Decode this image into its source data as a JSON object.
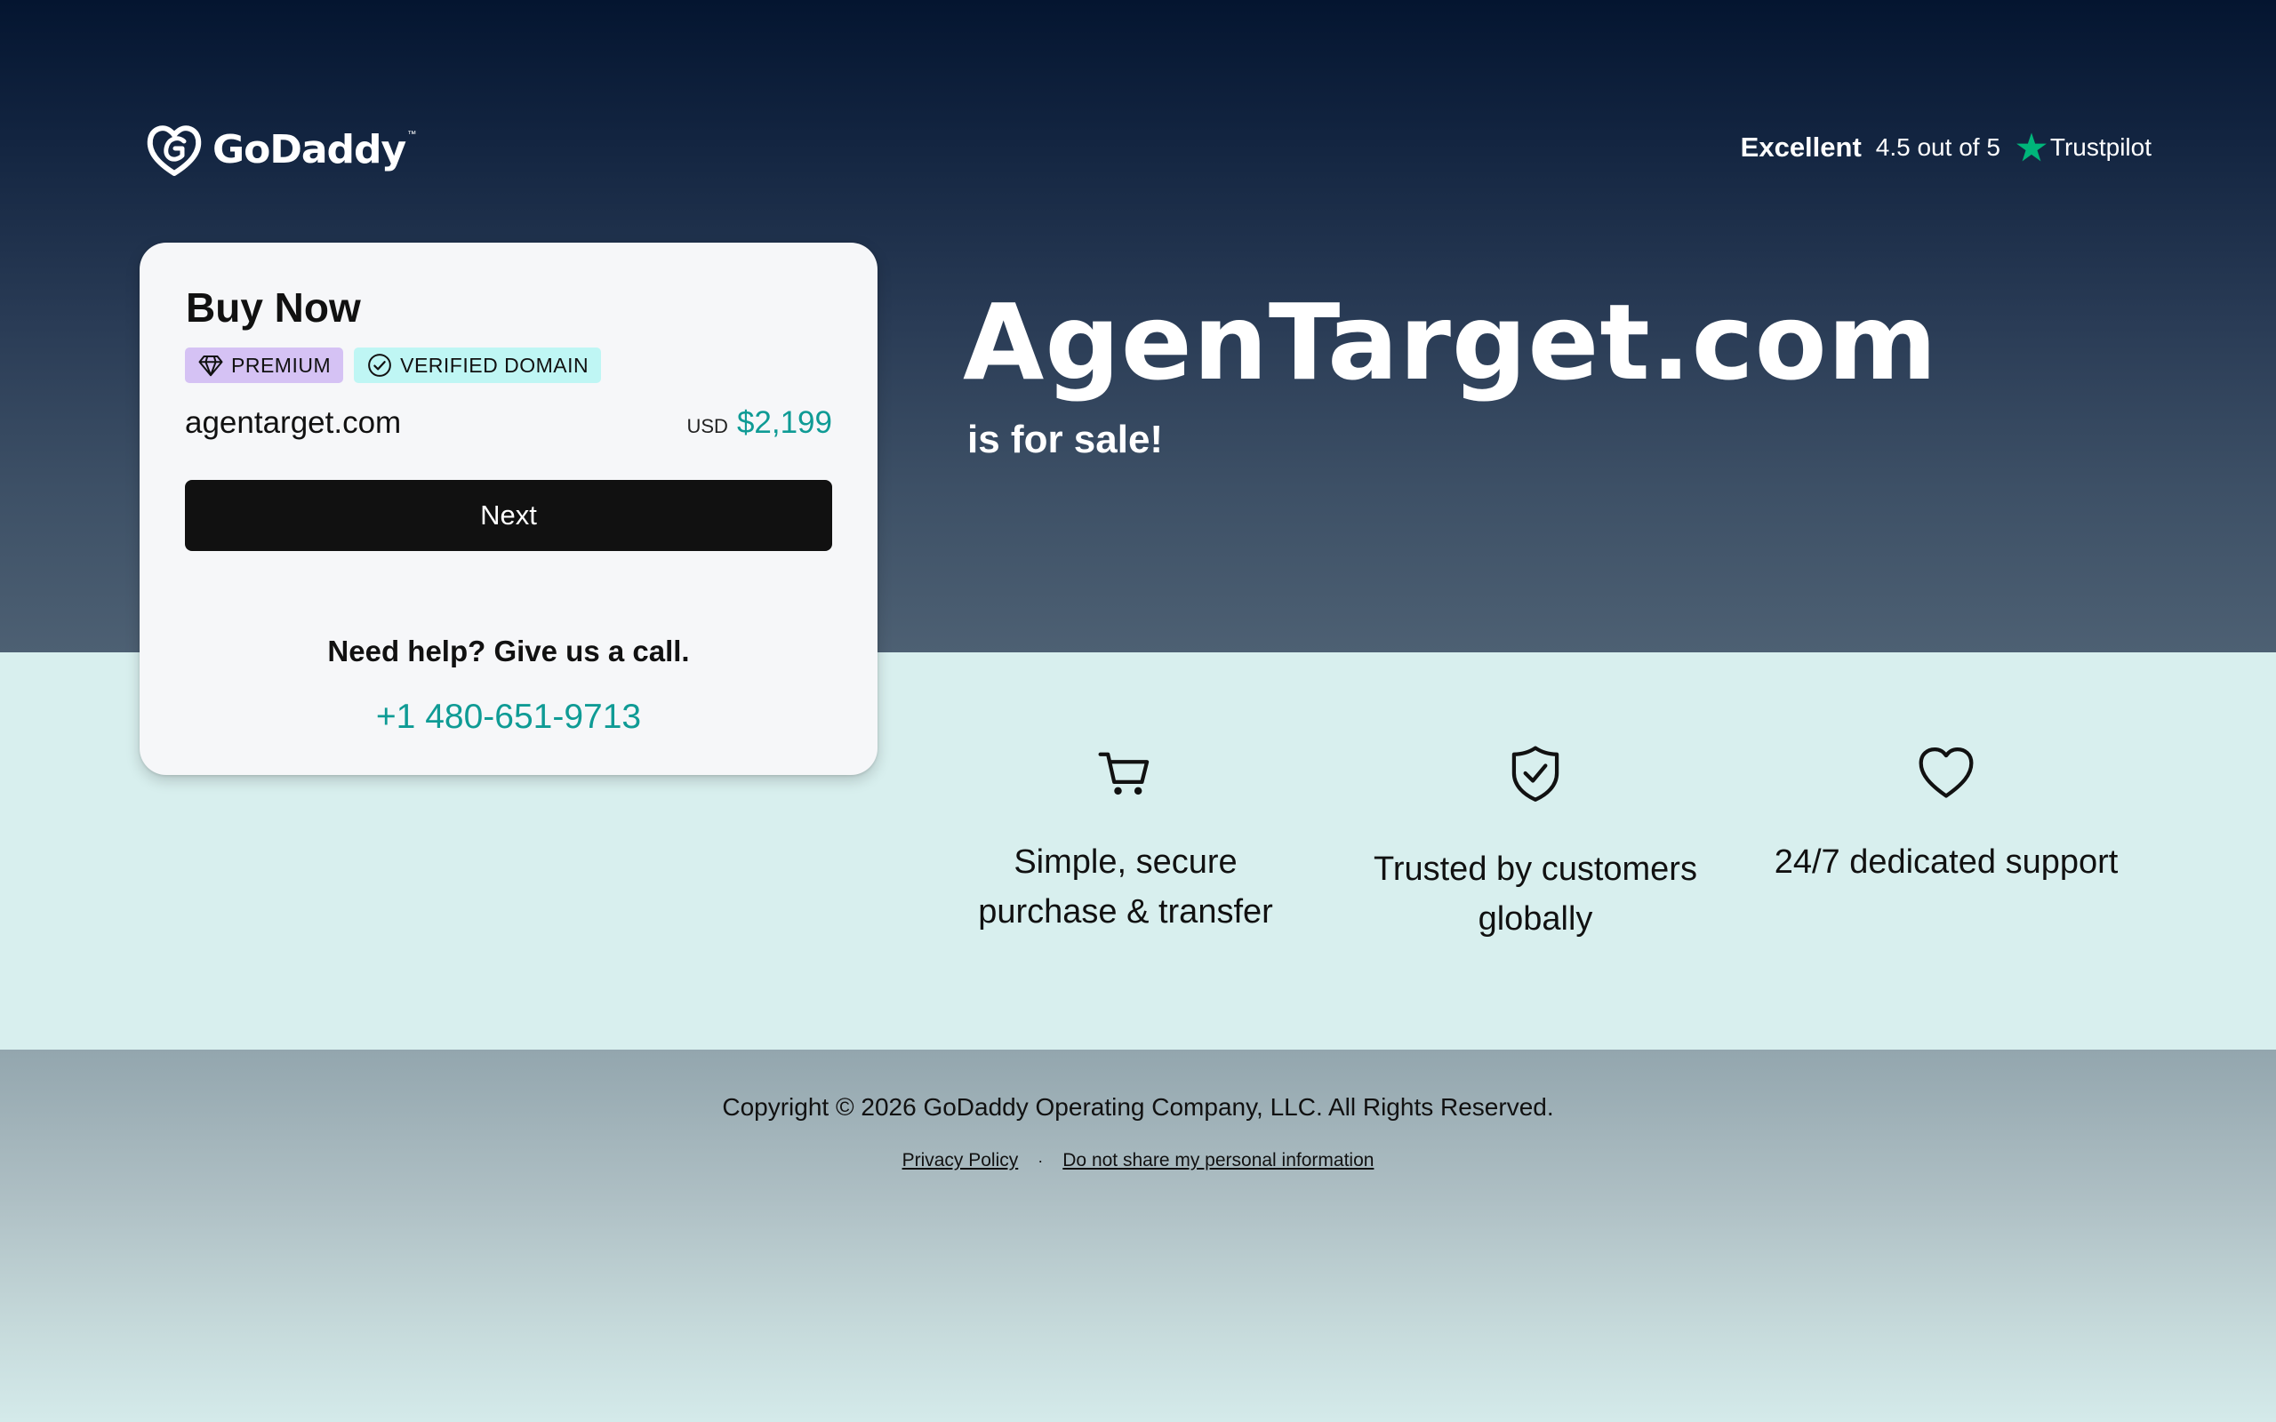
{
  "header": {
    "logo_text": "GoDaddy",
    "logo_tm": "™",
    "trustpilot": {
      "rating_word": "Excellent",
      "score": "4.5 out of 5",
      "brand": "Trustpilot"
    }
  },
  "buy_card": {
    "title": "Buy Now",
    "badges": {
      "premium": "PREMIUM",
      "verified": "VERIFIED DOMAIN"
    },
    "domain": "agentarget.com",
    "currency": "USD",
    "price": "$2,199",
    "next_label": "Next",
    "help_text": "Need help? Give us a call.",
    "phone": "+1 480-651-9713"
  },
  "hero": {
    "domain_title": "AgenTarget.com",
    "subtitle": "is for sale!"
  },
  "features": [
    {
      "icon": "cart-icon",
      "line1": "Simple, secure",
      "line2": "purchase & transfer"
    },
    {
      "icon": "shield-check-icon",
      "line1": "Trusted by customers",
      "line2": "globally"
    },
    {
      "icon": "heart-icon",
      "line1": "24/7 dedicated support"
    }
  ],
  "footer": {
    "copyright": "Copyright © 2026 GoDaddy Operating Company, LLC. All Rights Reserved.",
    "separator": "·",
    "links": [
      "Privacy Policy",
      "Do not share my personal information"
    ]
  },
  "colors": {
    "accent_teal": "#0f9b95",
    "trustpilot_green": "#00b67a",
    "premium_badge": "#d5c2f4",
    "verified_badge": "#bff6f4",
    "button_black": "#111111"
  }
}
